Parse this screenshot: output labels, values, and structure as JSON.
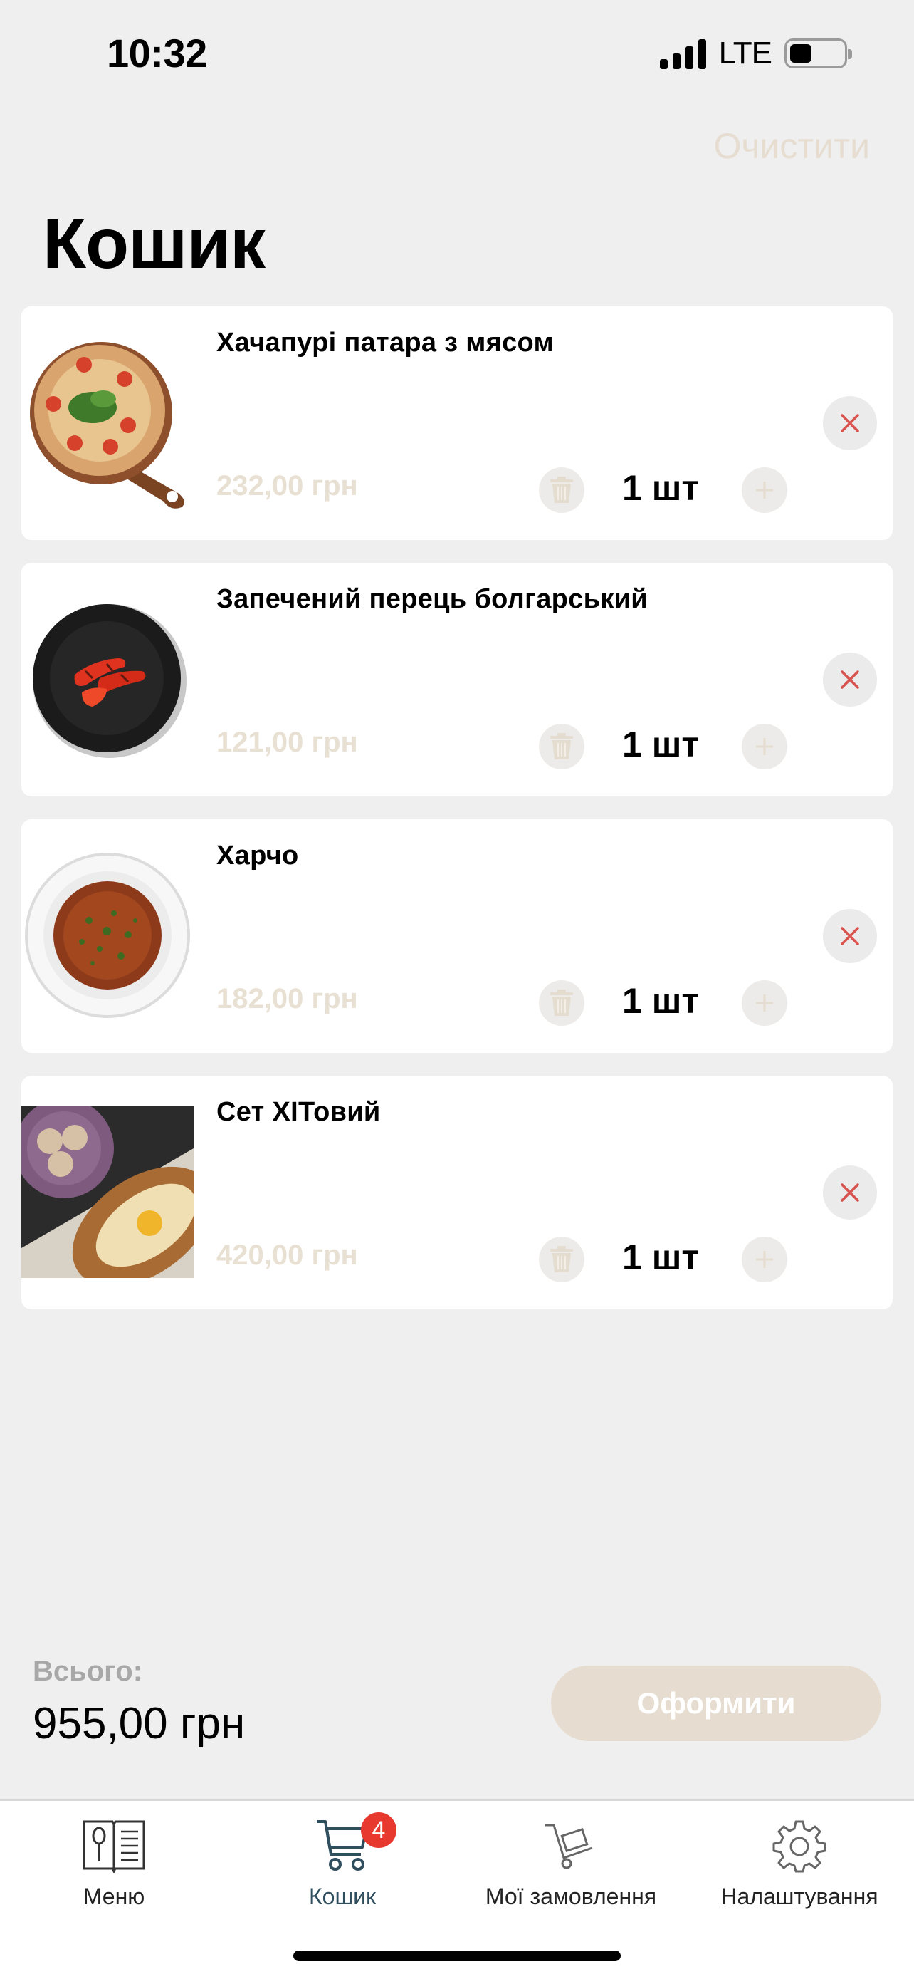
{
  "status_bar": {
    "time": "10:32",
    "network": "LTE"
  },
  "header": {
    "clear_label": "Очистити",
    "title": "Кошик"
  },
  "cart": {
    "items": [
      {
        "name": "Хачапурі патара з мясом",
        "price": "232,00 грн",
        "quantity": "1 шт",
        "image": "khachapuri-photo"
      },
      {
        "name": "Запечений перець болгарський",
        "price": "121,00 грн",
        "quantity": "1 шт",
        "image": "baked-pepper-photo"
      },
      {
        "name": "Харчо",
        "price": "182,00 грн",
        "quantity": "1 шт",
        "image": "kharcho-soup-photo"
      },
      {
        "name": "Сет ХІТовий",
        "price": "420,00 грн",
        "quantity": "1 шт",
        "image": "set-hitovyi-photo"
      }
    ]
  },
  "summary": {
    "total_label": "Всього:",
    "total_value": "955,00 грн",
    "checkout_label": "Оформити"
  },
  "tab_bar": {
    "tabs": [
      {
        "label": "Меню",
        "icon": "menu-book-icon"
      },
      {
        "label": "Кошик",
        "icon": "cart-icon",
        "badge": "4",
        "active": true
      },
      {
        "label": "Мої замовлення",
        "icon": "delivery-cart-icon"
      },
      {
        "label": "Налаштування",
        "icon": "gear-icon"
      }
    ]
  },
  "colors": {
    "background": "#efefef",
    "accent_beige": "#e6ddd0",
    "badge_red": "#e8392e",
    "remove_x": "#d9534f",
    "active_tab": "#2f4e5e"
  }
}
